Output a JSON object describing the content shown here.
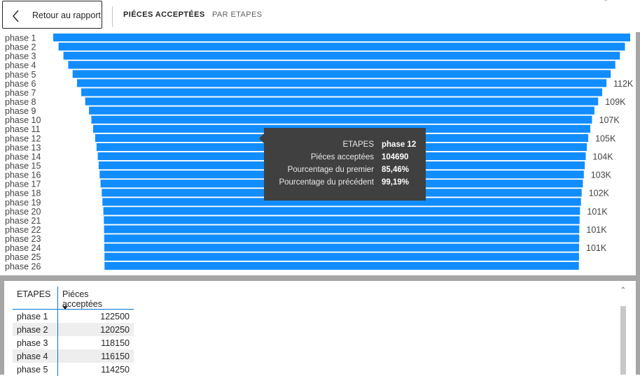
{
  "header": {
    "back_label": "Retour au rapport",
    "tabs": [
      {
        "label": "PIÉCES ACCEPTÉES",
        "active": true
      },
      {
        "label": "PAR ETAPES",
        "active": false
      }
    ]
  },
  "chart_data": {
    "type": "bar",
    "subtype": "funnel",
    "color": "#118DFF",
    "categories": [
      "phase 1",
      "phase 2",
      "phase 3",
      "phase 4",
      "phase 5",
      "phase 6",
      "phase 7",
      "phase 8",
      "phase 9",
      "phase 10",
      "phase 11",
      "phase 12",
      "phase 13",
      "phase 14",
      "phase 15",
      "phase 16",
      "phase 17",
      "phase 18",
      "phase 19",
      "phase 20",
      "phase 21",
      "phase 22",
      "phase 23",
      "phase 24",
      "phase 25",
      "phase 26"
    ],
    "values": [
      122500,
      120250,
      118150,
      116150,
      114250,
      112400,
      110600,
      108900,
      107300,
      106300,
      105550,
      104690,
      104100,
      103600,
      103200,
      102800,
      102400,
      101900,
      101600,
      101200,
      101000,
      100900,
      100850,
      100800,
      100750,
      100700
    ],
    "value_labels": [
      "",
      "",
      "",
      "",
      "",
      "112K",
      "",
      "109K",
      "",
      "107K",
      "",
      "105K",
      "",
      "104K",
      "",
      "103K",
      "",
      "102K",
      "",
      "101K",
      "",
      "101K",
      "",
      "101K",
      "",
      ""
    ]
  },
  "tooltip": {
    "rows": [
      {
        "key": "ETAPES",
        "value": "phase 12"
      },
      {
        "key": "Piéces acceptées",
        "value": "104690"
      },
      {
        "key": "Pourcentage du premier",
        "value": "85,46%"
      },
      {
        "key": "Pourcentage du précédent",
        "value": "99,19%"
      }
    ]
  },
  "table": {
    "headers": {
      "col1": "ETAPES",
      "col2": "Piéces acceptées"
    },
    "rows": [
      {
        "etape": "phase 1",
        "value": "122500"
      },
      {
        "etape": "phase 2",
        "value": "120250"
      },
      {
        "etape": "phase 3",
        "value": "118150"
      },
      {
        "etape": "phase 4",
        "value": "116150"
      },
      {
        "etape": "phase 5",
        "value": "114250"
      }
    ]
  },
  "scrollbar": {
    "up_icon": "chevron-up-icon"
  }
}
